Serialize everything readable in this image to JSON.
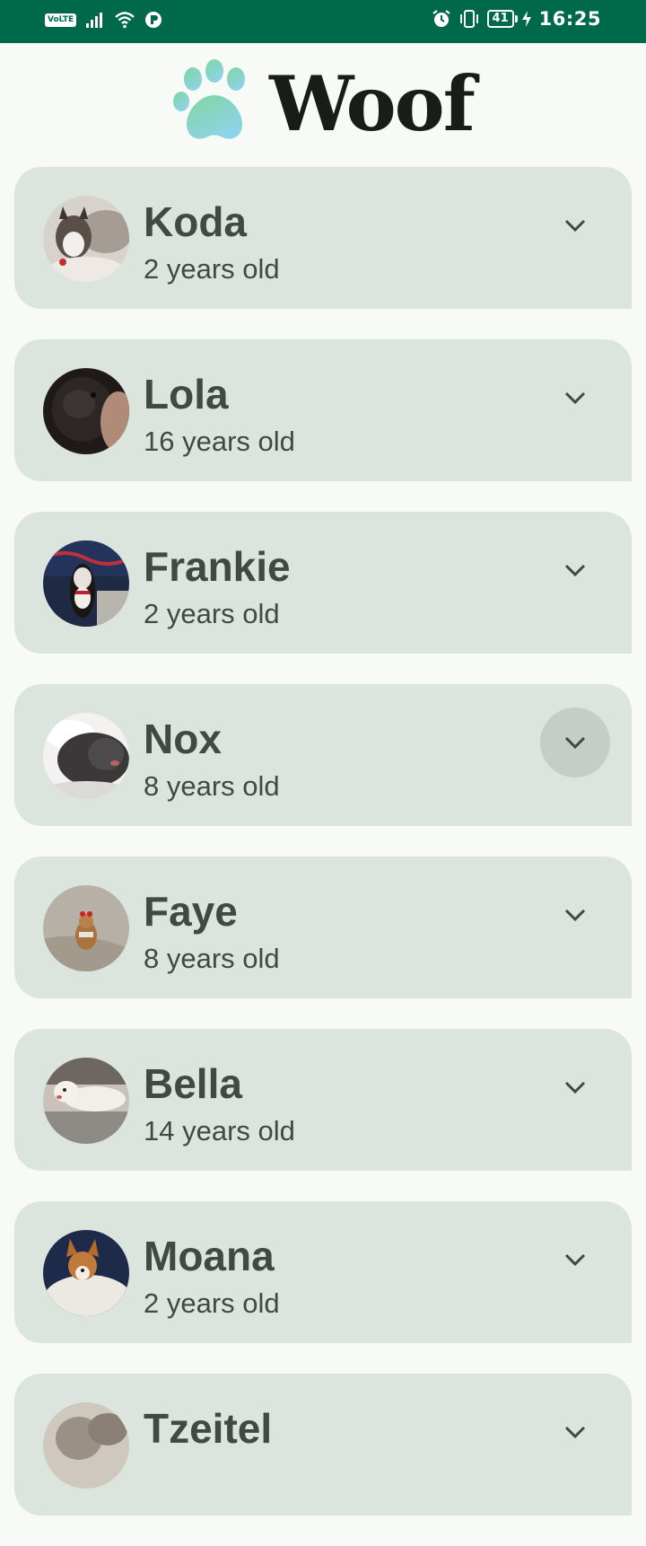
{
  "status_bar": {
    "volte": "VoLTE",
    "battery": "41",
    "time": "16:25"
  },
  "app": {
    "title": "Woof",
    "logo_icon": "paw-icon",
    "colors": {
      "status_bar": "#00694a",
      "background": "#f8faf7",
      "card": "#dbe5dd",
      "text": "#404943",
      "title": "#1a1c1a",
      "pressed": "#c4cdc6"
    }
  },
  "dogs": [
    {
      "name": "Koda",
      "age": "2 years old",
      "avatar_color": "#8a7a6a"
    },
    {
      "name": "Lola",
      "age": "16 years old",
      "avatar_color": "#3a3230"
    },
    {
      "name": "Frankie",
      "age": "2 years old",
      "avatar_color": "#2c3548"
    },
    {
      "name": "Nox",
      "age": "8 years old",
      "avatar_color": "#3e3e3e"
    },
    {
      "name": "Faye",
      "age": "8 years old",
      "avatar_color": "#a89a88"
    },
    {
      "name": "Bella",
      "age": "14 years old",
      "avatar_color": "#9c9082"
    },
    {
      "name": "Moana",
      "age": "2 years old",
      "avatar_color": "#2a3a5a"
    },
    {
      "name": "Tzeitel",
      "age": "",
      "avatar_color": "#8a8278"
    }
  ],
  "expand_icon": "chevron-down-icon"
}
